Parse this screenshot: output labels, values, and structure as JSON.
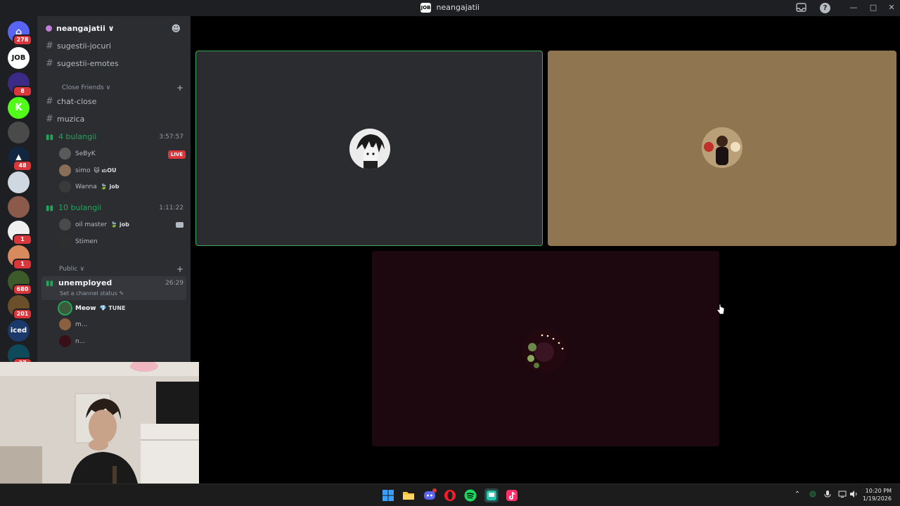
{
  "window": {
    "title": "neangajatii",
    "badge": "JOB"
  },
  "servers": [
    {
      "glyph": "⌂",
      "count": "278",
      "color": "#5865f2"
    },
    {
      "glyph": "JOB",
      "count": "",
      "color": "#ffffff"
    },
    {
      "glyph": "",
      "count": "8",
      "color": "#3b2a86"
    },
    {
      "glyph": "K",
      "count": "",
      "color": "#53fc18"
    },
    {
      "glyph": "",
      "count": "",
      "color": "#4a4a4a"
    },
    {
      "glyph": "▲",
      "count": "48",
      "color": "#12263f"
    },
    {
      "glyph": "",
      "count": "",
      "color": "#cfd8e0"
    },
    {
      "glyph": "",
      "count": "",
      "color": "#8b5a4a"
    },
    {
      "glyph": "",
      "count": "1",
      "color": "#efefef"
    },
    {
      "glyph": "",
      "count": "1",
      "color": "#d98a5c"
    },
    {
      "glyph": "",
      "count": "680",
      "color": "#3d5a2a"
    },
    {
      "glyph": "",
      "count": "201",
      "color": "#6b4e2a"
    },
    {
      "glyph": "iced",
      "count": "",
      "color": "#1b3a6b"
    },
    {
      "glyph": "",
      "count": "37",
      "color": "#0e4a5a"
    }
  ],
  "guild": {
    "name": "neangajatii ∨"
  },
  "channels": {
    "text_top": [
      "sugestii-jocuri",
      "sugestii-emotes"
    ],
    "category_close": "Close Friends ∨",
    "text_close": [
      "chat-close",
      "muzica"
    ],
    "voice1": {
      "name": "4 bulangii",
      "time": "3:57:57"
    },
    "voice1_members": [
      {
        "name": "SeByK",
        "tag": "",
        "live": "LIVE"
      },
      {
        "name": "simo",
        "tag": "🐱 ಮOU"
      },
      {
        "name": "Wanna",
        "tag": "🍃 job"
      }
    ],
    "voice2": {
      "name": "10 bulangii",
      "time": "1:11:22"
    },
    "voice2_members": [
      {
        "name": "oil master",
        "tag": "🍃 job"
      },
      {
        "name": "Stimen",
        "tag": ""
      }
    ],
    "category_public": "Public ∨",
    "voice3": {
      "name": "unemployed",
      "time": "26:29",
      "status": "Set a channel status ✎"
    },
    "voice3_members": [
      {
        "name": "Meow",
        "tag": "💎 TUNE"
      },
      {
        "name": "m...",
        "tag": ""
      },
      {
        "name": "n...",
        "tag": ""
      }
    ]
  },
  "taskbar": {
    "time": "10:20 PM",
    "date": "1/19/2026",
    "apps": [
      "windows-start",
      "file-explorer",
      "discord",
      "opera",
      "spotify",
      "twitch",
      "tiktok"
    ]
  },
  "colors": {
    "speaking_border": "#3ba55c",
    "tile_dark": "#2b2c30",
    "tile_tan": "#8f7550",
    "tile_maroon": "#1e0810",
    "live_red": "#da373c"
  }
}
